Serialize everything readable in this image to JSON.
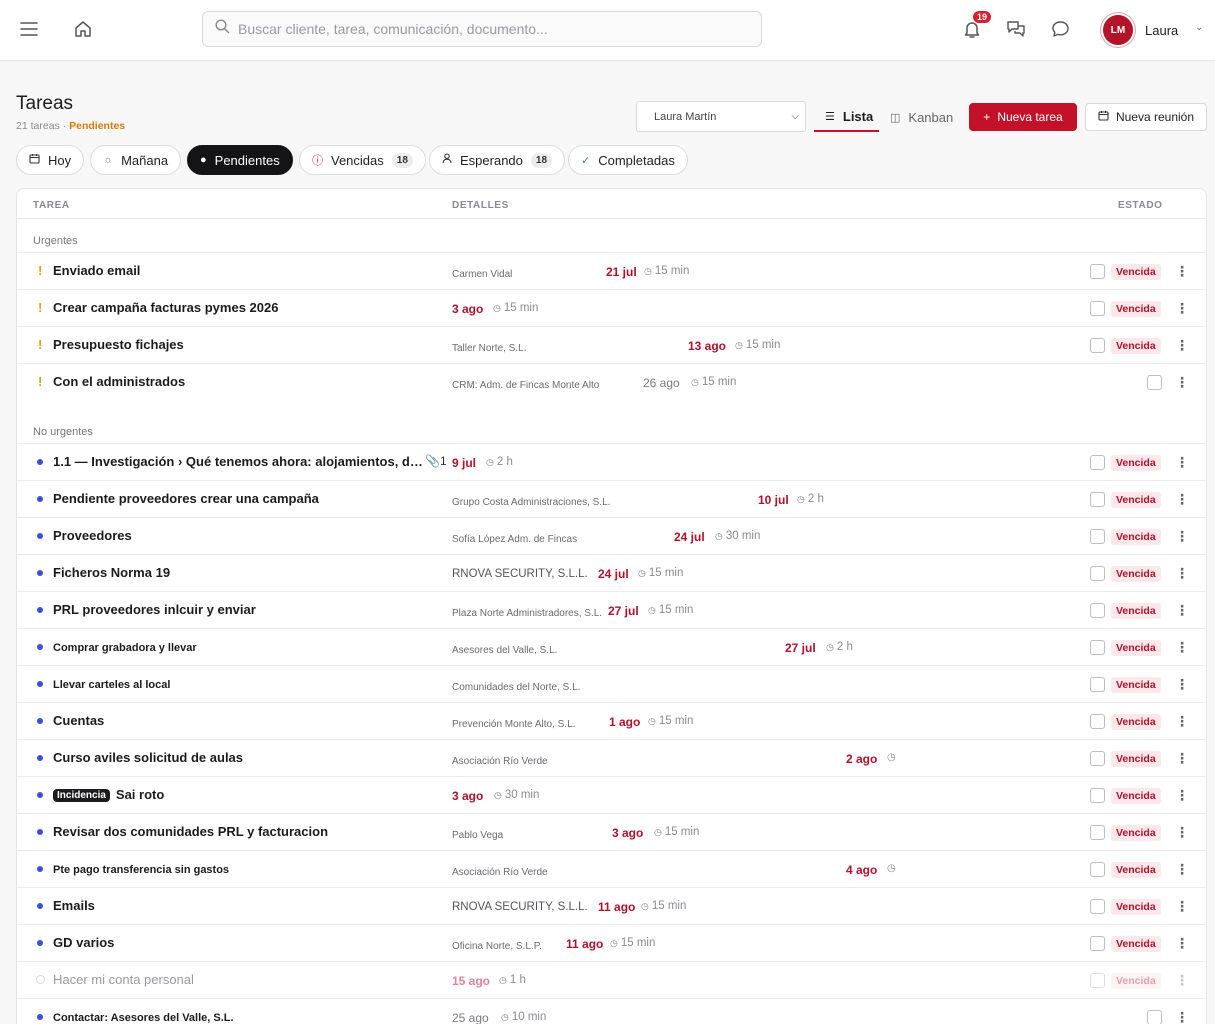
{
  "topbar": {
    "search_placeholder": "Buscar cliente, tarea, comunicación, documento...",
    "notifications_count": "19",
    "avatar_initials": "LM",
    "user_name": "Laura"
  },
  "header": {
    "title": "Tareas",
    "count_text": "21 tareas",
    "separator": "·",
    "filter_text": "Pendientes",
    "user_select_value": "Laura Martín",
    "view_list": "Lista",
    "view_kanban": "Kanban",
    "new_task": "Nueva tarea",
    "new_meeting": "Nueva reunión"
  },
  "filters": [
    {
      "label": "Hoy"
    },
    {
      "label": "Mañana"
    },
    {
      "label": "Pendientes"
    },
    {
      "label": "Vencidas",
      "count": "18"
    },
    {
      "label": "Esperando",
      "count": "18"
    },
    {
      "label": "Completadas"
    }
  ],
  "table": {
    "col_task": "TAREA",
    "col_details": "DETALLES",
    "col_status": "ESTADO",
    "group_urgent": "Urgentes",
    "group_not_urgent": "No urgentes"
  },
  "urgent_rows": [
    {
      "title": "Enviado email",
      "client": "Carmen Vidal",
      "date": "21 jul",
      "duration": "15 min",
      "status": "Vencida"
    },
    {
      "title": "Crear campaña facturas pymes 2026",
      "client": "",
      "date": "3 ago",
      "duration": "15 min",
      "status": "Vencida"
    },
    {
      "title": "Presupuesto fichajes",
      "client": "Taller Norte, S.L.",
      "date": "13 ago",
      "duration": "15 min",
      "status": "Vencida"
    },
    {
      "title": "Con el administrados",
      "client": "CRM: Adm. de Fincas Monte Alto",
      "date": "26 ago",
      "duration": "15 min",
      "status": ""
    }
  ],
  "rows": [
    {
      "title": "1.1 — Investigación › Qué tenemos ahora: alojamientos, do...",
      "attachments": "1",
      "client": "",
      "date": "9 jul",
      "duration": "2 h",
      "status": "Vencida"
    },
    {
      "title": "Pendiente proveedores crear una campaña",
      "client": "Grupo Costa Administraciones, S.L.",
      "date": "10 jul",
      "duration": "2 h",
      "status": "Vencida"
    },
    {
      "title": "Proveedores",
      "client": "Sofía López Adm. de Fincas",
      "date": "24 jul",
      "duration": "30 min",
      "status": "Vencida"
    },
    {
      "title": "Ficheros Norma 19",
      "client": "RNOVA SECURITY, S.L.L.",
      "date": "24 jul",
      "duration": "15 min",
      "status": "Vencida"
    },
    {
      "title": "PRL proveedores inlcuir y enviar",
      "client": "Plaza Norte Administradores, S.L.",
      "date": "27 jul",
      "duration": "15 min",
      "status": "Vencida"
    },
    {
      "title": "Comprar grabadora y llevar",
      "client": "Asesores del Valle, S.L.",
      "date": "27 jul",
      "duration": "2 h",
      "status": "Vencida"
    },
    {
      "title": "Llevar carteles al local",
      "client": "Comunidades del Norte, S.L.",
      "date": "",
      "duration": "",
      "status": "Vencida"
    },
    {
      "title": "Cuentas",
      "client": "Prevención Monte Alto, S.L.",
      "date": "1 ago",
      "duration": "15 min",
      "status": "Vencida"
    },
    {
      "title": "Curso aviles solicitud de aulas",
      "client": "Asociación Río Verde",
      "date": "2 ago",
      "duration": "",
      "status": "Vencida"
    },
    {
      "tag": "Incidencia",
      "title": "Sai roto",
      "client": "",
      "date": "3 ago",
      "duration": "30 min",
      "status": "Vencida"
    },
    {
      "title": "Revisar dos comunidades PRL y facturacion",
      "client": "Pablo Vega",
      "date": "3 ago",
      "duration": "15 min",
      "status": "Vencida"
    },
    {
      "title": "Pte pago transferencia sin gastos",
      "client": "Asociación Río Verde",
      "date": "4 ago",
      "duration": "",
      "status": "Vencida"
    },
    {
      "title": "Emails",
      "client": "RNOVA SECURITY, S.L.L.",
      "date": "11 ago",
      "duration": "15 min",
      "status": "Vencida"
    },
    {
      "title": "GD varios",
      "client": "Oficina Norte, S.L.P.",
      "date": "11 ago",
      "duration": "15 min",
      "status": "Vencida"
    },
    {
      "title": "Hacer mi conta personal",
      "client": "",
      "date": "15 ago",
      "duration": "1 h",
      "status": "Vencida"
    },
    {
      "title": "Contactar: Asesores del Valle, S.L.",
      "client": "",
      "date": "25 ago",
      "duration": "10 min",
      "status": ""
    }
  ]
}
